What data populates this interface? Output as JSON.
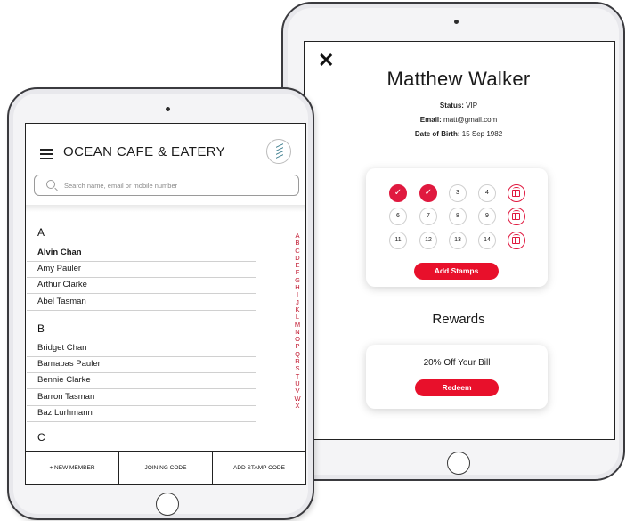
{
  "app": {
    "title": "OCEAN CAFE & EATERY",
    "search_placeholder": "Search name, email or mobile number"
  },
  "member_list": {
    "sections": [
      {
        "letter": "A",
        "names": [
          "Alvin Chan",
          "Amy Pauler",
          "Arthur Clarke",
          "Abel Tasman"
        ]
      },
      {
        "letter": "B",
        "names": [
          "Bridget Chan",
          "Barnabas Pauler",
          "Bennie Clarke",
          "Barron Tasman",
          "Baz Lurhmann"
        ]
      },
      {
        "letter": "C",
        "names": []
      }
    ],
    "alphabet": [
      "A",
      "B",
      "C",
      "D",
      "E",
      "F",
      "G",
      "H",
      "I",
      "J",
      "K",
      "L",
      "M",
      "N",
      "O",
      "P",
      "Q",
      "R",
      "S",
      "T",
      "U",
      "V",
      "W",
      "X"
    ]
  },
  "bottom_bar": {
    "new_member": "+ NEW MEMBER",
    "joining_code": "JOINING CODE",
    "add_stamp_code": "ADD STAMP CODE"
  },
  "customer": {
    "close_glyph": "✕",
    "name": "Matthew Walker",
    "status_label": "Status:",
    "status_value": "VIP",
    "email_label": "Email:",
    "email_value": "matt@gmail.com",
    "dob_label": "Date of Birth:",
    "dob_value": "15 Sep 1982"
  },
  "stamp_card": {
    "check_glyph": "✓",
    "stamps": [
      {
        "label": "1",
        "state": "done"
      },
      {
        "label": "2",
        "state": "done"
      },
      {
        "label": "3",
        "state": "empty"
      },
      {
        "label": "4",
        "state": "empty"
      },
      {
        "label": "gift",
        "state": "gift"
      },
      {
        "label": "6",
        "state": "empty"
      },
      {
        "label": "7",
        "state": "empty"
      },
      {
        "label": "8",
        "state": "empty"
      },
      {
        "label": "9",
        "state": "empty"
      },
      {
        "label": "gift",
        "state": "gift"
      },
      {
        "label": "11",
        "state": "empty"
      },
      {
        "label": "12",
        "state": "empty"
      },
      {
        "label": "13",
        "state": "empty"
      },
      {
        "label": "14",
        "state": "empty"
      },
      {
        "label": "gift",
        "state": "gift"
      }
    ],
    "button_label": "Add Stamps"
  },
  "rewards": {
    "title": "Rewards",
    "items": [
      {
        "text": "20% Off Your Bill",
        "button_label": "Redeem"
      }
    ]
  },
  "colors": {
    "accent": "#e8102b",
    "alphabet_index": "#c0152d"
  },
  "icons": {
    "menu": "hamburger-icon",
    "search": "search-icon",
    "logo": "cafe-logo",
    "close": "close-icon",
    "check": "check-icon",
    "gift": "gift-icon"
  }
}
